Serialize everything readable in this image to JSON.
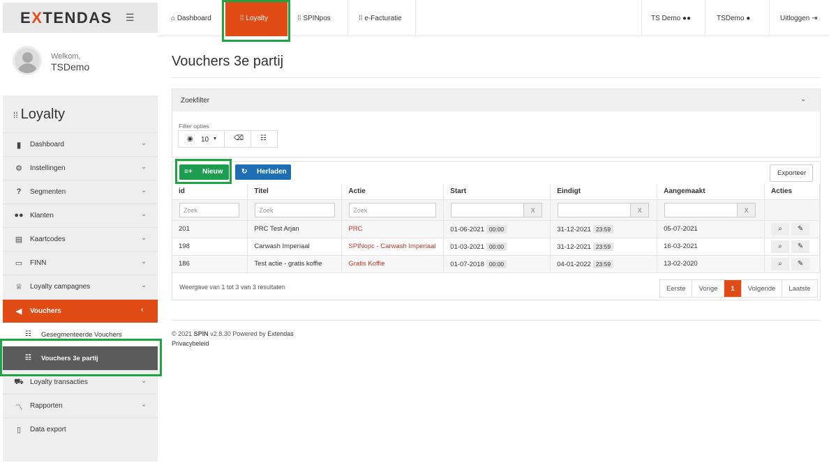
{
  "brand": {
    "name_prefix": "E",
    "name_x": "X",
    "name_suffix": "TENDAS"
  },
  "user": {
    "greeting": "Welkom,",
    "name": "TSDemo"
  },
  "module_title": "Loyalty",
  "sidebar": {
    "items": [
      {
        "label": "Dashboard",
        "icon": "bar-chart-icon",
        "glyph": "▮"
      },
      {
        "label": "Instellingen",
        "icon": "gear-icon",
        "glyph": "⚙"
      },
      {
        "label": "Segmenten",
        "icon": "question-icon",
        "glyph": "?"
      },
      {
        "label": "Klanten",
        "icon": "users-icon",
        "glyph": "👥"
      },
      {
        "label": "Kaartcodes",
        "icon": "barcode-icon",
        "glyph": "▤"
      },
      {
        "label": "FINN",
        "icon": "card-icon",
        "glyph": "▭"
      },
      {
        "label": "Loyalty campagnes",
        "icon": "trophy-icon",
        "glyph": "🏆"
      },
      {
        "label": "Vouchers",
        "icon": "bullhorn-icon",
        "glyph": "📣"
      },
      {
        "label": "Loyalty transacties",
        "icon": "cart-icon",
        "glyph": "🛒"
      },
      {
        "label": "Rapporten",
        "icon": "line-chart-icon",
        "glyph": "〽"
      },
      {
        "label": "Data export",
        "icon": "file-icon",
        "glyph": "▯"
      }
    ],
    "subitems": [
      {
        "label": "Gesegmenteerde Vouchers",
        "icon": "list-icon"
      },
      {
        "label": "Vouchers 3e partij",
        "icon": "list-icon"
      }
    ]
  },
  "topnav": {
    "tabs": [
      "Dashboard",
      "Loyalty",
      "SPINpos",
      "e-Facturatie"
    ],
    "right": [
      "TS Demo",
      "TSDemo",
      "Uitloggen"
    ]
  },
  "page": {
    "title": "Vouchers 3e partij"
  },
  "filter": {
    "title": "Zoekfilter",
    "options_label": "Filter opties",
    "page_size": "10"
  },
  "toolbar": {
    "new_label": "Nieuw",
    "reload_label": "Herladen",
    "export_label": "Exporteer"
  },
  "table": {
    "columns": [
      "id",
      "Titel",
      "Actie",
      "Start",
      "Eindigt",
      "Aangemaakt",
      "Acties"
    ],
    "search_placeholder": "Zoek",
    "clear_label": "X",
    "rows": [
      {
        "id": "201",
        "title": "PRC Test Arjan",
        "action": "PRC",
        "start_date": "01-06-2021",
        "start_time": "00:00",
        "end_date": "31-12-2021",
        "end_time": "23:59",
        "created": "05-07-2021"
      },
      {
        "id": "198",
        "title": "Carwash Imperiaal",
        "action": "SPINopc - Carwash Imperiaal",
        "start_date": "01-03-2021",
        "start_time": "00:00",
        "end_date": "31-12-2021",
        "end_time": "23:59",
        "created": "16-03-2021"
      },
      {
        "id": "186",
        "title": "Test actie - gratis koffie",
        "action": "Gratis Koffie",
        "start_date": "01-07-2018",
        "start_time": "00:00",
        "end_date": "04-01-2022",
        "end_time": "23:59",
        "created": "13-02-2020"
      }
    ]
  },
  "result_info": "Weergave van 1 tot 3 van 3 resultaten",
  "pager": [
    "Eerste",
    "Vorige",
    "1",
    "Volgende",
    "Laatste"
  ],
  "footer": {
    "copyright": "© 2021",
    "app": "SPIN",
    "version": "v2.8.30 Powered by",
    "company": "Extendas",
    "privacy": "Privacybeleid"
  },
  "colors": {
    "accent": "#e14b16",
    "new_button": "#1d9d50",
    "reload_button": "#1e6eb3",
    "highlight": "#1fa443"
  }
}
